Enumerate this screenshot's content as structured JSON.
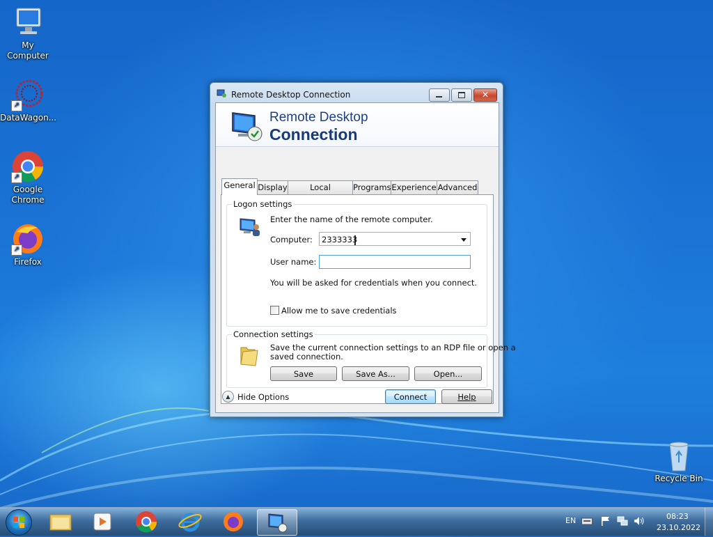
{
  "desktop": {
    "icons": [
      {
        "label": "My Computer",
        "icon": "computer-icon"
      },
      {
        "label": "DataWagon...",
        "icon": "datawagon-icon"
      },
      {
        "label": "Google Chrome",
        "icon": "chrome-icon"
      },
      {
        "label": "Firefox",
        "icon": "firefox-icon"
      },
      {
        "label": "Recycle Bin",
        "icon": "recycle-bin-icon"
      }
    ]
  },
  "window": {
    "title": "Remote Desktop Connection",
    "banner_line1": "Remote Desktop",
    "banner_line2": "Connection",
    "tabs": [
      {
        "label": "General",
        "active": true
      },
      {
        "label": "Display"
      },
      {
        "label": "Local Resources"
      },
      {
        "label": "Programs"
      },
      {
        "label": "Experience"
      },
      {
        "label": "Advanced"
      }
    ],
    "logon": {
      "group_title": "Logon settings",
      "instructions": "Enter the name of the remote computer.",
      "computer_label": "Computer:",
      "computer_value": "2333333",
      "username_label": "User name:",
      "username_value": "",
      "credentials_note": "You will be asked for credentials when you connect.",
      "save_credentials_label": "Allow me to save credentials",
      "save_credentials_checked": false
    },
    "connection": {
      "group_title": "Connection settings",
      "description_line1": "Save the current connection settings to an RDP file or open a",
      "description_line2": "saved connection.",
      "save_label": "Save",
      "save_as_label": "Save As...",
      "open_label": "Open..."
    },
    "hide_options_label": "Hide Options",
    "connect_label": "Connect",
    "help_label": "Help"
  },
  "taskbar": {
    "items": [
      "file-explorer-icon",
      "media-player-icon",
      "chrome-icon",
      "internet-explorer-icon",
      "firefox-icon",
      "remote-desktop-icon"
    ],
    "language": "EN",
    "time": "08:23",
    "date": "23.10.2022"
  },
  "colors": {
    "accent": "#3c7fb1",
    "banner_text": "#1d3f86",
    "desktop": "#1a74d6"
  }
}
